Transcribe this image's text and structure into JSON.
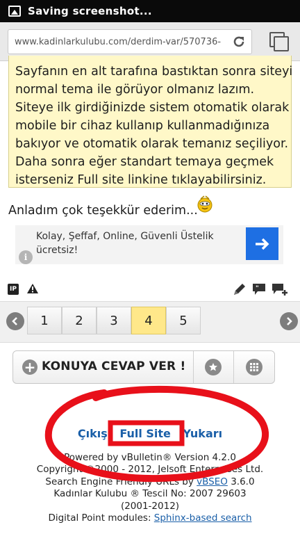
{
  "status_bar": {
    "text": "Saving screenshot..."
  },
  "browser": {
    "url": "www.kadinlarkulubu.com/derdim-var/570736-"
  },
  "post": {
    "body": "Sayfanın en alt tarafına bastıktan sonra siteyi normal tema ile görüyor olmanız lazım. Siteye ilk girdiğinizde sistem otomatik olarak mobile bir cihaz kullanıp kullanmadığınıza bakıyor ve otomatik olarak temanız seçiliyor. Daha sonra eğer standart temaya geçmek isterseniz Full site linkine tıklayabilirsiniz.",
    "reply_text": "Anladım çok teşekkür ederim..."
  },
  "ad": {
    "text": "Kolay, Şeffaf, Online, Güvenli Üstelik ücretsiz!"
  },
  "post_tools": {
    "ip_label": "IP"
  },
  "pagination": {
    "pages": [
      "1",
      "2",
      "3",
      "4",
      "5"
    ],
    "current": "4"
  },
  "reply_bar": {
    "label": "KONUYA CEVAP VER !"
  },
  "footer": {
    "links": {
      "exit": "Çıkış",
      "full_site": "Full Site",
      "top": "Yukarı"
    },
    "powered_by": "Powered by vBulletin® Version 4.2.0",
    "copyright": "Copyright ©2000 - 2012, Jelsoft Enterprises Ltd.",
    "seo_prefix": "Search Engine Friendly URLs by ",
    "seo_link": "vBSEO",
    "seo_suffix": " 3.6.0",
    "trademark": "Kadınlar Kulubu ® Tescil No: 2007 29603",
    "years": "(2001-2012)",
    "dp_prefix": "Digital Point modules: ",
    "dp_link": "Sphinx-based search"
  },
  "colors": {
    "accent_yellow": "#fff8c8",
    "link_blue": "#1a5fa8",
    "ad_button": "#1e6fe3",
    "annotation_red": "#e8101a",
    "current_page": "#ffe88a"
  }
}
